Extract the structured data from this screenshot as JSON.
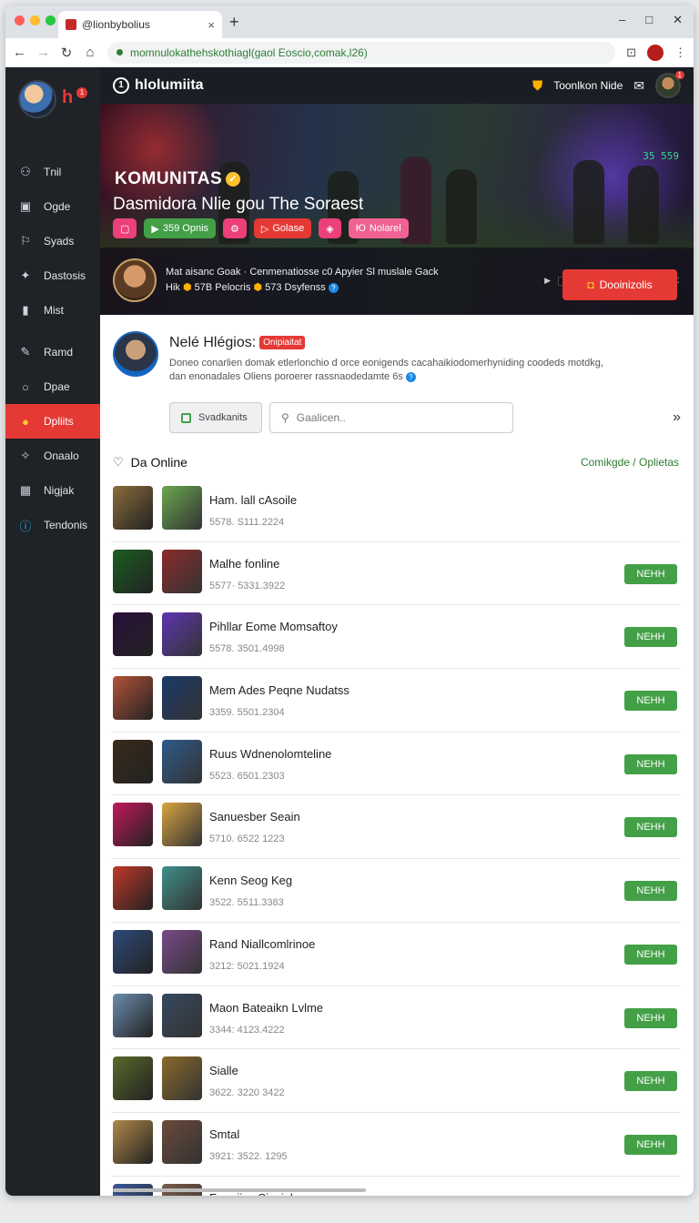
{
  "browser": {
    "tab_title": "@lionbybolius",
    "tab_close": "×",
    "new_tab": "+",
    "url": "momnulokathehskothiagl(gaol Eoscio,comak,l26)",
    "controls": [
      "–",
      "□",
      "✕"
    ]
  },
  "sidebar": {
    "brand": "h",
    "badge": "1",
    "items": [
      {
        "label": "Tnil",
        "icon": "user-icon",
        "glyph": "⚇"
      },
      {
        "label": "Ogde",
        "icon": "grid-icon",
        "glyph": "▣"
      },
      {
        "label": "Syads",
        "icon": "flag-icon",
        "glyph": "⚐"
      },
      {
        "label": "Dastosis",
        "icon": "star-icon",
        "glyph": "✦"
      },
      {
        "label": "Mist",
        "icon": "list-icon",
        "glyph": "▮"
      },
      {
        "label": "Ramd",
        "icon": "tool-icon",
        "glyph": "✎"
      },
      {
        "label": "Dpae",
        "icon": "circle-icon",
        "glyph": "○"
      },
      {
        "label": "Dpliits",
        "icon": "coin-icon",
        "glyph": "●",
        "active": true
      },
      {
        "label": "Onaalo",
        "icon": "pin-icon",
        "glyph": "✧"
      },
      {
        "label": "Nigjak",
        "icon": "calendar-icon",
        "glyph": "▦"
      },
      {
        "label": "Tendonis",
        "icon": "info-icon",
        "glyph": "ⓘ"
      }
    ]
  },
  "topnav": {
    "logo_glyph": "1",
    "logo_text": "hlolumiita",
    "user_label": "Toonlkon Nide",
    "notif": "1"
  },
  "hero": {
    "title": "KOMUNITAS",
    "verified": "✓",
    "subtitle": "Dasmidora Nlie  ɡou The Soraest",
    "counter": "35 559",
    "pills": [
      {
        "label": "",
        "glyph": "▢",
        "color": "#ec407a"
      },
      {
        "label": "359 Opnis",
        "glyph": "▶",
        "color": "#43a047"
      },
      {
        "label": "",
        "glyph": "⚙",
        "color": "#ec407a"
      },
      {
        "label": "Golase",
        "glyph": "▷",
        "color": "#e53935"
      },
      {
        "label": "",
        "glyph": "◈",
        "color": "#ec407a"
      },
      {
        "label": "Nolarel",
        "glyph": "Ю",
        "color": "#f06292"
      }
    ],
    "creator_line1": "Mat aisanc Goak  ·  Cenmenatiosse c0 Apyier Sl muslale Gack",
    "creator_line2a": "Hik",
    "creator_line2b": "57B Pelocris",
    "creator_line2c": "573 Dsyfenss",
    "join_label": "Dooinizolis"
  },
  "profile": {
    "name": "Nelé Hlégios:",
    "tag": "Onipiaitat",
    "description": "Doneo conarlien domak etlerlonchio d orce eonigends cacahaikiodomerhyniding coodeds motdkg, dan enonadales",
    "description_tail": "Oliens poroerer rassnaodedamte 6s",
    "filter_label": "Svadkanits",
    "search_placeholder": "Gaalicen.."
  },
  "list": {
    "heading": "Da Online",
    "right_link": "Comikgde / Oplietas",
    "button_label": "NEHH",
    "rows": [
      {
        "title": "Ham. lall cAsoile",
        "meta": "5578.  S111.2224",
        "button": false,
        "ca": "#8a6d3b",
        "cb": "#6aa84f"
      },
      {
        "title": "Malhe fonline",
        "meta": "5577·  5331.3922",
        "button": true,
        "ca": "#1b5e20",
        "cb": "#8b2b2b"
      },
      {
        "title": "Pihllar Eome Momsaftoy",
        "meta": "5578.  3501.4998",
        "button": true,
        "ca": "#2a0f3a",
        "cb": "#5e35b1"
      },
      {
        "title": "Mem Ades Peqne Nudatss",
        "meta": "3359.  5501.2304",
        "button": true,
        "ca": "#b4533a",
        "cb": "#1a3a6a"
      },
      {
        "title": "Ruus Wdnenolomteline",
        "meta": "5523.  6501.2303",
        "button": true,
        "ca": "#3a2a1a",
        "cb": "#2f5a8a"
      },
      {
        "title": "Sanuesber Seain",
        "meta": "5710.  6522 1223",
        "button": true,
        "ca": "#c2185b",
        "cb": "#d9a441"
      },
      {
        "title": "Kenn Seog Keg",
        "meta": "3522.  5511.3383",
        "button": true,
        "ca": "#c0392b",
        "cb": "#3f8f8a"
      },
      {
        "title": "Rand Niallcomlrinoe",
        "meta": "3212:  5021.1924",
        "button": true,
        "ca": "#2e4a7a",
        "cb": "#7a4a8a"
      },
      {
        "title": "Maon Bateaikn Lvlme",
        "meta": "3344:  4123.4222",
        "button": true,
        "ca": "#6b8cae",
        "cb": "#34495e"
      },
      {
        "title": "Sialle",
        "meta": "3622.  3220 3422",
        "button": true,
        "ca": "#5a6a2a",
        "cb": "#8a6a2a"
      },
      {
        "title": "Smtal",
        "meta": "3921:  3522. 1295",
        "button": true,
        "ca": "#b08a4a",
        "cb": "#6a4a3a"
      },
      {
        "title": "Fomrijos Siaciol",
        "meta": "",
        "button": true,
        "ca": "#3a5a9a",
        "cb": "#7a5a4a"
      }
    ]
  }
}
